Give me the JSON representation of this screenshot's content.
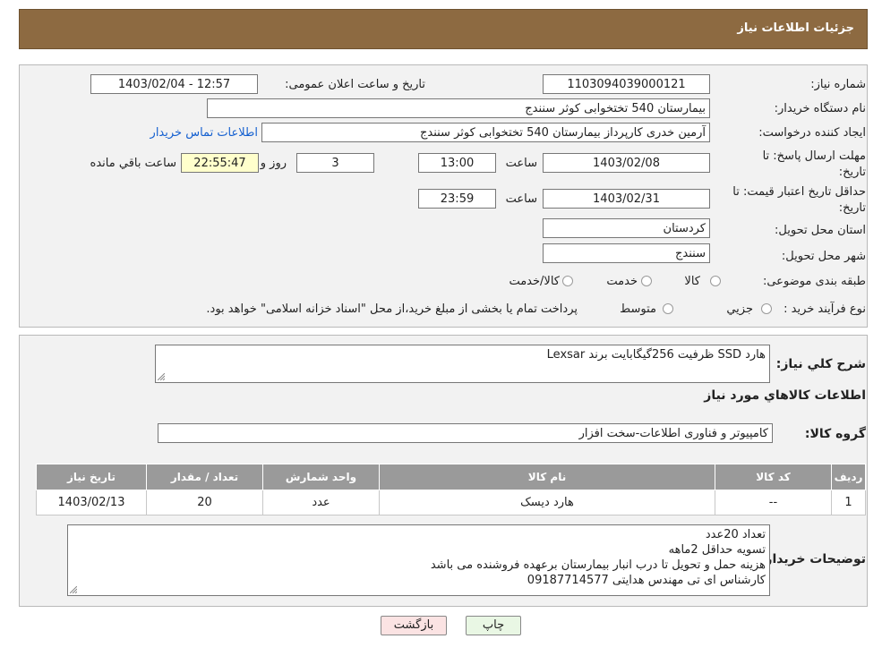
{
  "header": {
    "title": "جزئیات اطلاعات نیاز"
  },
  "fields": {
    "need_number_label": "شماره نیاز:",
    "need_number": "1103094039000121",
    "announce_label": "تاریخ و ساعت اعلان عمومی:",
    "announce_value": "1403/02/04 - 12:57",
    "buyer_org_label": "نام دستگاه خریدار:",
    "buyer_org": "بیمارستان 540 تختخوابی کوثر سنندج",
    "requester_label": "ایجاد کننده درخواست:",
    "requester": "آرمین خدری کارپرداز بیمارستان 540 تختخوابی کوثر سنندج",
    "contact_link": "اطلاعات تماس خریدار",
    "deadline_label_1": "مهلت ارسال پاسخ: تا",
    "deadline_label_2": "تاریخ:",
    "deadline_date": "1403/02/08",
    "time_label": "ساعت",
    "deadline_time": "13:00",
    "days_value": "3",
    "days_label": "روز و",
    "remaining_time": "22:55:47",
    "remaining_label": "ساعت باقي مانده",
    "validity_label_1": "حداقل تاریخ اعتبار قیمت: تا",
    "validity_label_2": "تاریخ:",
    "validity_date": "1403/02/31",
    "validity_time": "23:59",
    "province_label": "استان محل تحویل:",
    "province": "کردستان",
    "city_label": "شهر محل تحویل:",
    "city": "سنندج",
    "category_label": "طبقه بندی موضوعی:",
    "category_options": [
      "کالا",
      "خدمت",
      "کالا/خدمت"
    ],
    "process_label": "نوع فرآیند خرید :",
    "process_options": [
      "جزیي",
      "متوسط"
    ],
    "process_note": "پرداخت تمام یا بخشی از مبلغ خرید،از محل \"اسناد خزانه اسلامی\" خواهد بود."
  },
  "details": {
    "description_label": "شرح کلي نياز:",
    "description": "هارد SSD ظرفیت 256گیگابایت برند Lexsar",
    "goods_info_title": "اطلاعات کالاهاي مورد نياز",
    "goods_group_label": "گروه کالا:",
    "goods_group": "کامپیوتر و فناوری اطلاعات-سخت افزار"
  },
  "table": {
    "headers": [
      "رديف",
      "کد کالا",
      "نام کالا",
      "واحد شمارش",
      "تعداد / مقدار",
      "تاریخ نیاز"
    ],
    "rows": [
      [
        "1",
        "--",
        "هارد دیسک",
        "عدد",
        "20",
        "1403/02/13"
      ]
    ]
  },
  "buyer_notes": {
    "label": "توضیحات خریدار:",
    "lines": [
      "تعداد 20عدد",
      "تسویه حداقل 2ماهه",
      "هزینه حمل و تحویل تا درب انبار بیمارستان برعهده فروشنده می باشد",
      "کارشناس ای تی مهندس هدایتی 09187714577"
    ]
  },
  "buttons": {
    "print": "چاپ",
    "back": "بازگشت"
  },
  "colors": {
    "header_bg": "#8d6a41",
    "table_header": "#9a9a9a",
    "print_bg": "#e9f7e4",
    "back_bg": "#fbe3e3"
  }
}
